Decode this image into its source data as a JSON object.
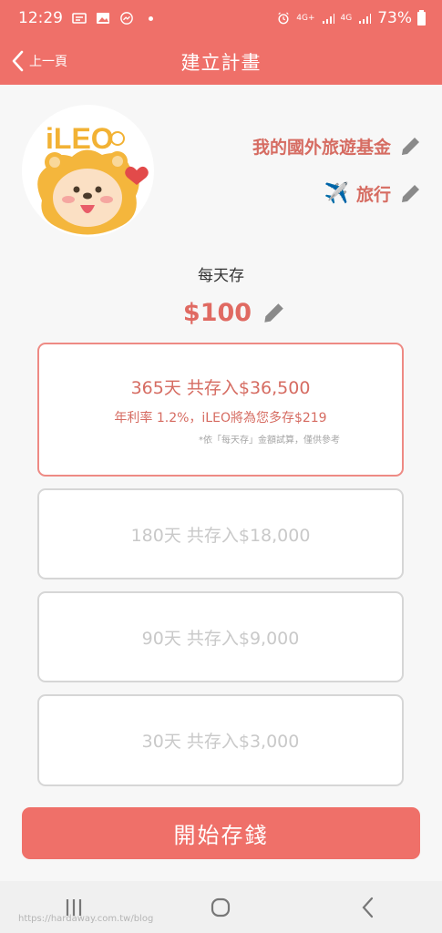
{
  "status_bar": {
    "time": "12:29",
    "net_top": "4G+",
    "net_label": "4G",
    "battery": "73%"
  },
  "header": {
    "back_label": "上一頁",
    "title": "建立計畫"
  },
  "plan": {
    "name": "我的國外旅遊基金",
    "category": "旅行",
    "category_emoji": "✈️"
  },
  "logo_text": "iLEO",
  "daily": {
    "label": "每天存",
    "amount": "$100"
  },
  "options": [
    {
      "main": "365天 共存入$36,500",
      "interest": "年利率 1.2%，iLEO將為您多存$219",
      "note": "*依「每天存」金額試算，僅供參考"
    },
    {
      "main": "180天 共存入$18,000"
    },
    {
      "main": "90天 共存入$9,000"
    },
    {
      "main": "30天 共存入$3,000"
    }
  ],
  "start_button": "開始存錢",
  "watermark": "https://hardaway.com.tw/blog",
  "colors": {
    "accent": "#ef7069",
    "text_accent": "#d66c62",
    "inactive": "#c9c9c9"
  }
}
